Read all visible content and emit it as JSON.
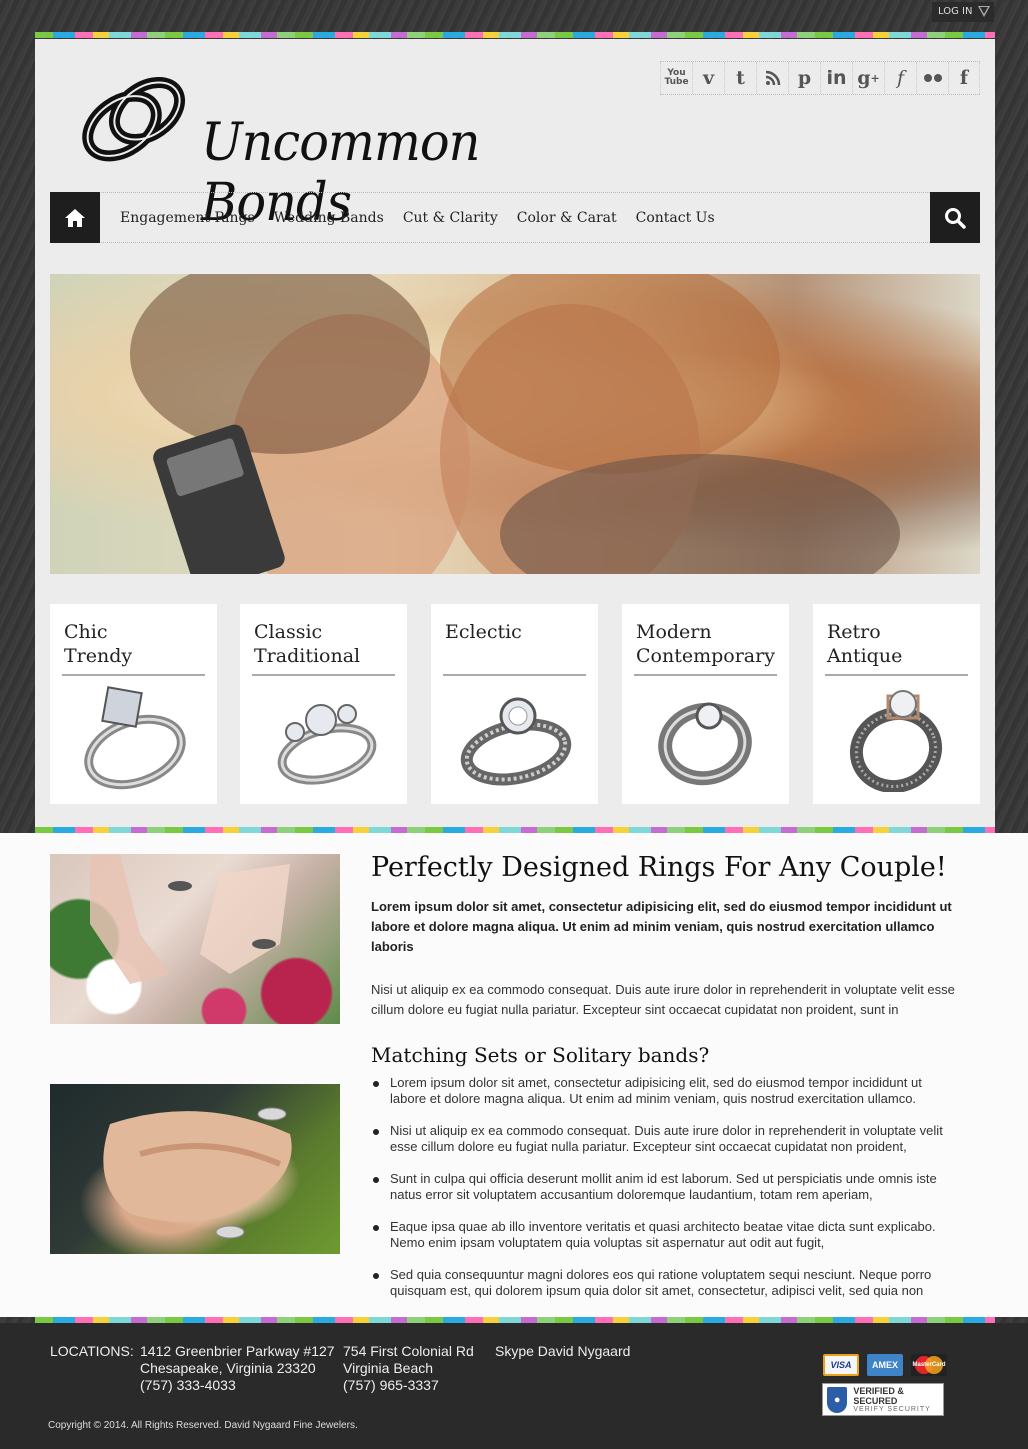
{
  "topbar": {
    "login_label": "LOG IN"
  },
  "header": {
    "logo_text": "Uncommon Bonds",
    "social": [
      {
        "name": "youtube-icon",
        "glyph": "You\nTube"
      },
      {
        "name": "vimeo-icon",
        "glyph": "v"
      },
      {
        "name": "tumblr-icon",
        "glyph": "t"
      },
      {
        "name": "rss-icon",
        "glyph": "rss"
      },
      {
        "name": "pinterest-icon",
        "glyph": "p"
      },
      {
        "name": "linkedin-icon",
        "glyph": "in"
      },
      {
        "name": "google-plus-icon",
        "glyph": "g+"
      },
      {
        "name": "friendfeed-icon",
        "glyph": "f"
      },
      {
        "name": "flickr-icon",
        "glyph": "••"
      },
      {
        "name": "facebook-icon",
        "glyph": "f"
      }
    ]
  },
  "nav": {
    "items": [
      {
        "label": "Engagement Rings"
      },
      {
        "label": "Wedding Bands"
      },
      {
        "label": "Cut & Clarity"
      },
      {
        "label": "Color & Carat"
      },
      {
        "label": "Contact Us"
      }
    ]
  },
  "categories": [
    {
      "title": "Chic\nTrendy"
    },
    {
      "title": "Classic\nTraditional"
    },
    {
      "title": "Eclectic"
    },
    {
      "title": "Modern\nContemporary"
    },
    {
      "title": "Retro\nAntique"
    }
  ],
  "article": {
    "heading": "Perfectly Designed Rings For Any Couple!",
    "lead": "Lorem ipsum dolor sit amet, consectetur adipisicing elit, sed do eiusmod tempor incididunt ut labore et dolore magna aliqua. Ut enim ad minim veniam, quis nostrud exercitation ullamco laboris",
    "paragraph": "Nisi ut aliquip ex ea commodo consequat. Duis aute irure dolor in reprehenderit in voluptate velit esse cillum dolore eu fugiat nulla pariatur. Excepteur sint occaecat cupidatat non proident, sunt in",
    "subheading": "Matching Sets or Solitary bands?",
    "bullets": [
      "Lorem ipsum dolor sit amet, consectetur adipisicing elit, sed do eiusmod tempor incididunt ut labore et dolore magna aliqua. Ut enim ad minim veniam, quis nostrud exercitation ullamco.",
      "Nisi ut aliquip ex ea commodo consequat. Duis aute irure dolor in reprehenderit in voluptate velit esse cillum dolore eu fugiat nulla pariatur. Excepteur sint occaecat cupidatat non proident,",
      "Sunt in culpa qui officia deserunt mollit anim id est laborum. Sed ut perspiciatis unde omnis iste natus error sit voluptatem accusantium doloremque laudantium, totam rem aperiam,",
      "Eaque ipsa quae ab illo inventore veritatis et quasi architecto beatae vitae dicta sunt explicabo. Nemo enim ipsam voluptatem quia voluptas sit aspernatur aut odit aut fugit,",
      "Sed quia consequuntur magni dolores eos qui ratione voluptatem sequi nesciunt. Neque porro quisquam est, qui dolorem ipsum quia dolor sit amet, consectetur, adipisci velit, sed quia non"
    ]
  },
  "footer": {
    "locations_label": "LOCATIONS:",
    "location1": {
      "line1": "1412 Greenbrier Parkway #127",
      "line2": "Chesapeake, Virginia 23320",
      "line3": "(757) 333-4033"
    },
    "location2": {
      "line1": "754 First Colonial Rd",
      "line2": "Virginia Beach",
      "line3": "(757) 965-3337"
    },
    "skype": "Skype David Nygaard",
    "copyright": "Copyright © 2014. All Rights Reserved. David Nygaard Fine Jewelers.",
    "cards": {
      "visa": "VISA",
      "amex": "AMEX",
      "mastercard": "MasterCard"
    },
    "secured": {
      "line1": "VERIFIED & SECURED",
      "line2": "VERIFY SECURITY"
    }
  },
  "colors": {
    "accent": "#1e1e1e",
    "panel": "#ececec",
    "footer": "#2a2a2a"
  }
}
